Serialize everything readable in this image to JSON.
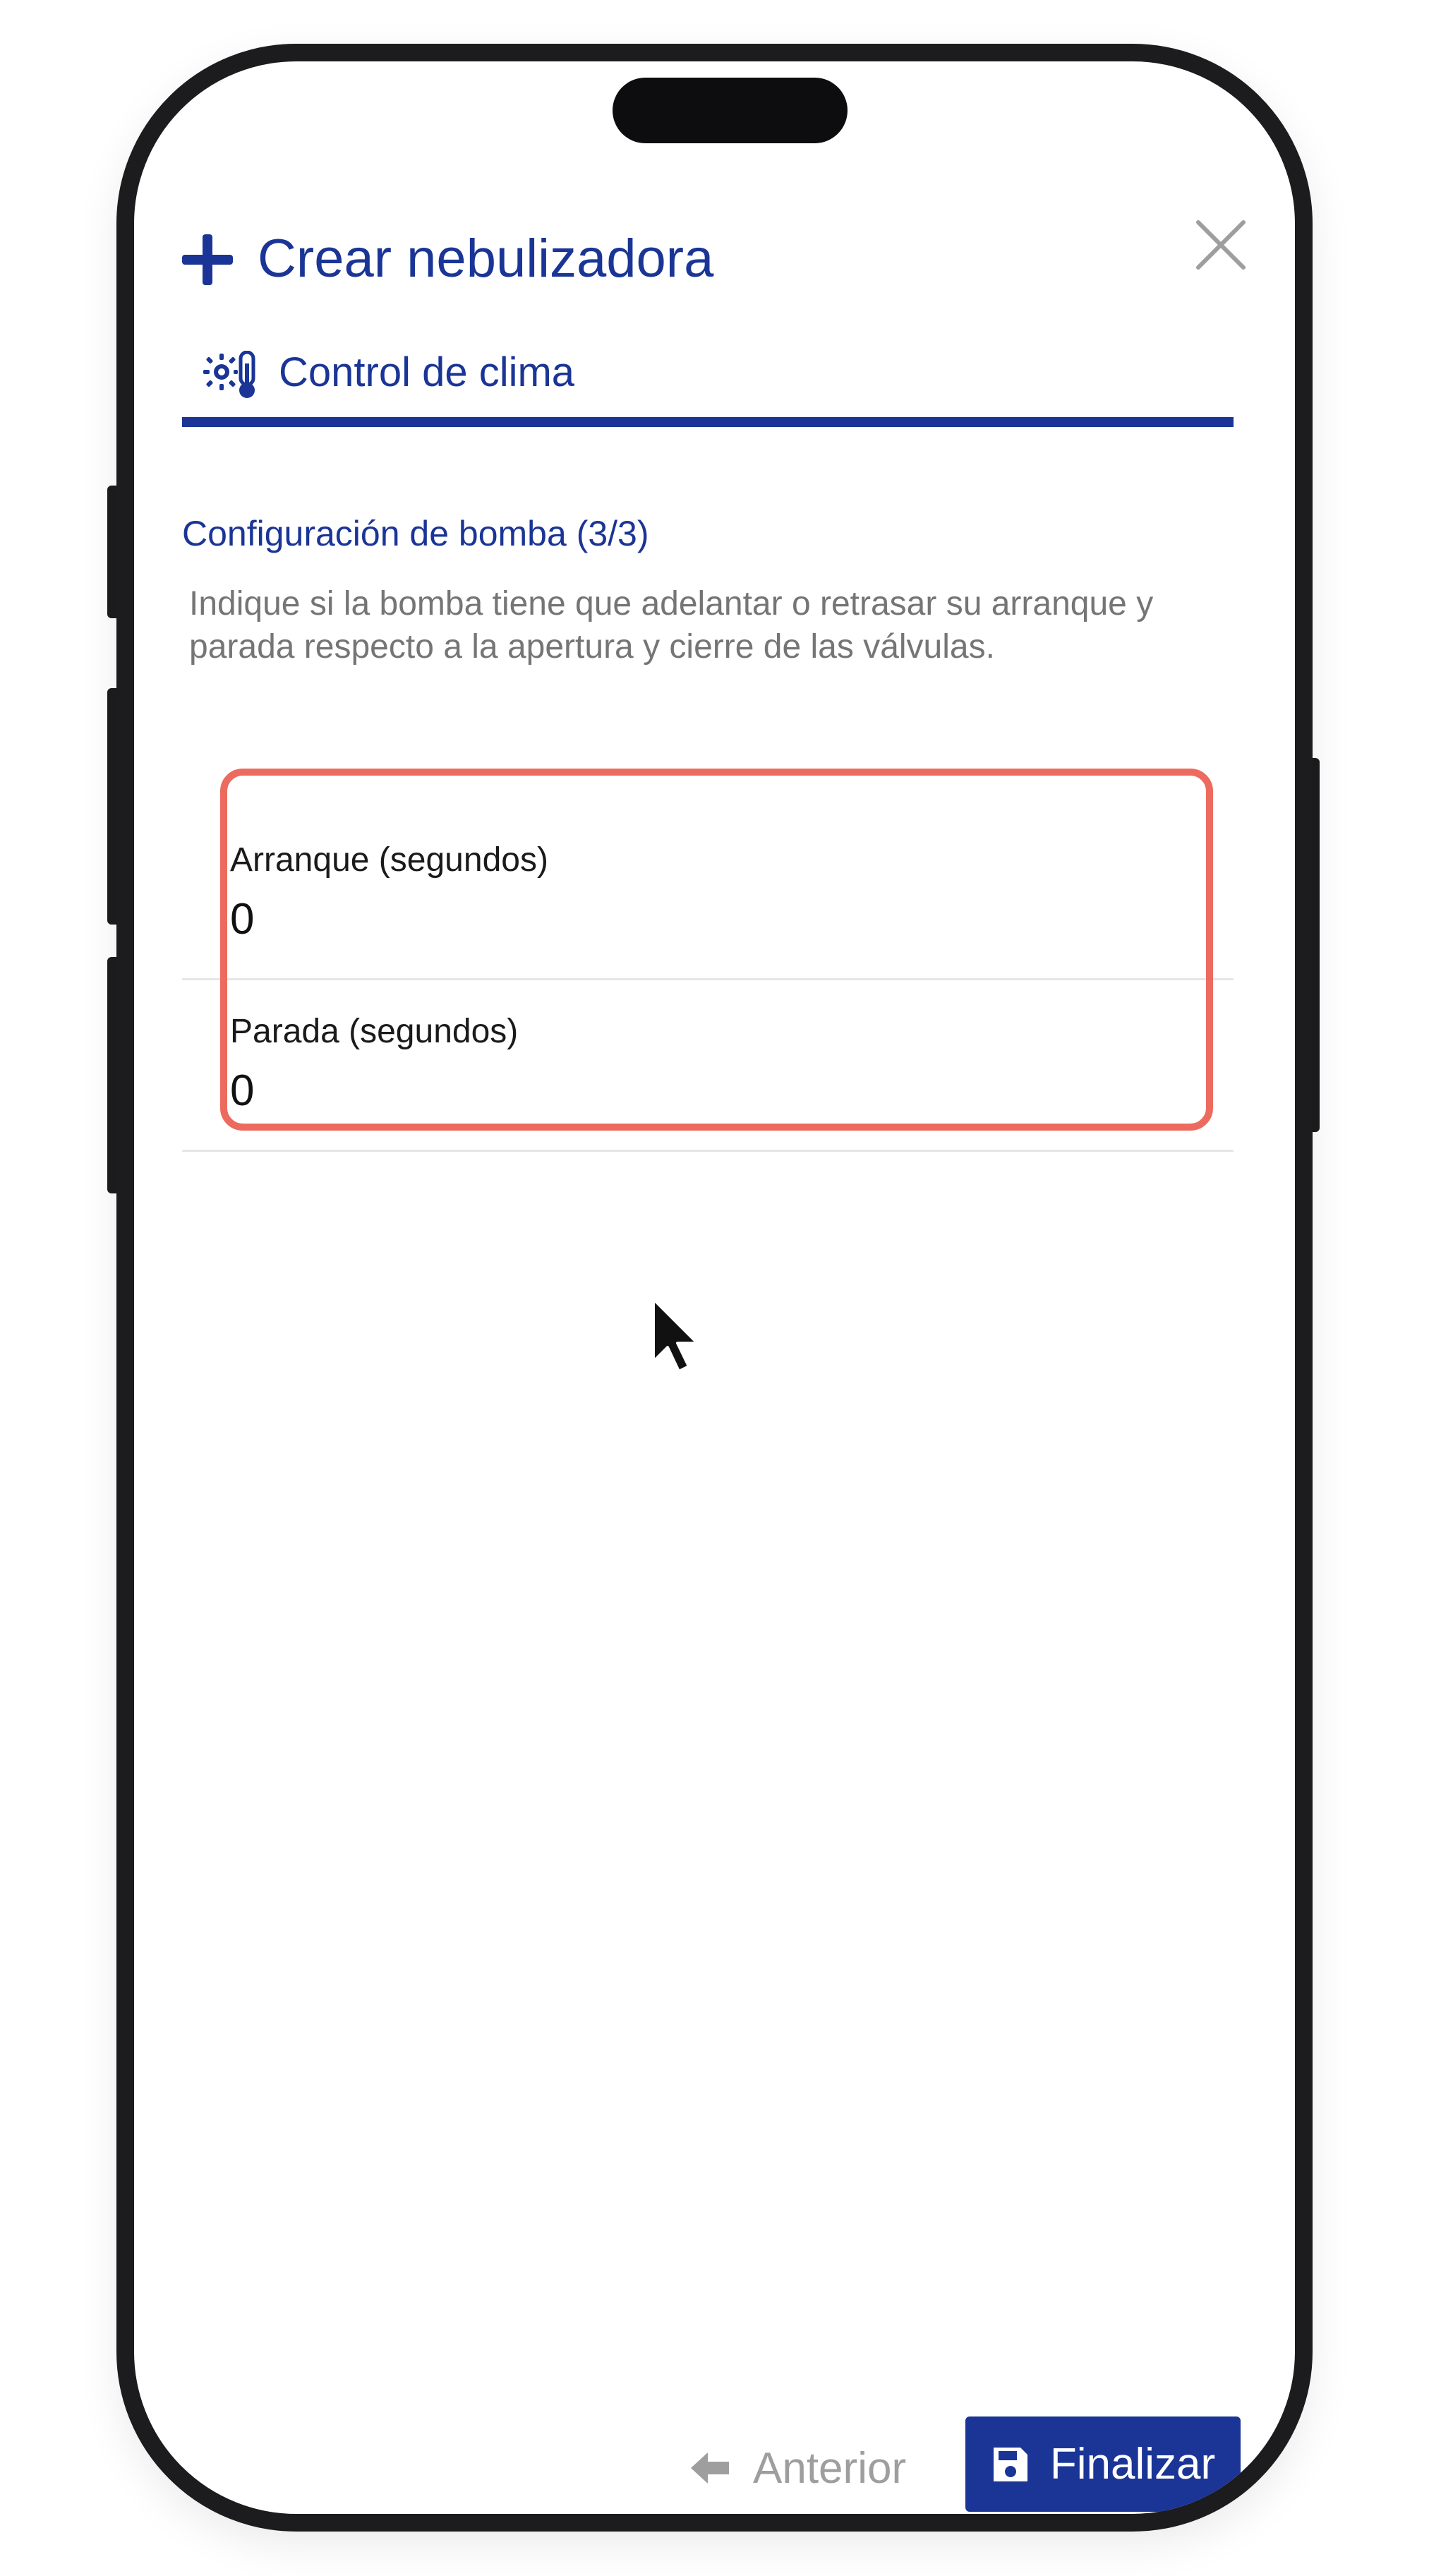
{
  "colors": {
    "accent": "#1a3596",
    "muted_text": "#757575",
    "highlight": "#ec6b5e",
    "divider": "#e6e6e6"
  },
  "header": {
    "title": "Crear nebulizadora",
    "plus_icon": "plus-icon",
    "close_icon": "close-icon"
  },
  "tab": {
    "label": "Control de clima",
    "icon": "climate-control-icon"
  },
  "section": {
    "title": "Configuración de bomba (3/3)",
    "description": "Indique si la bomba tiene que adelantar o retrasar su arranque y parada respecto a la apertura y cierre de las válvulas."
  },
  "fields": [
    {
      "label": "Arranque (segundos)",
      "value": "0"
    },
    {
      "label": "Parada (segundos)",
      "value": "0"
    }
  ],
  "footer": {
    "prev_label": "Anterior",
    "prev_icon": "arrow-left-icon",
    "finish_label": "Finalizar",
    "finish_icon": "save-icon"
  }
}
